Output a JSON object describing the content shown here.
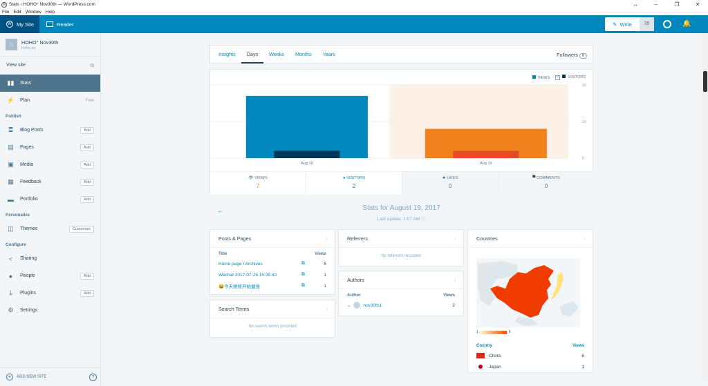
{
  "window": {
    "title": "Stats ‹ HOHO° Nov30th — WordPress.com",
    "menu": [
      "File",
      "Edit",
      "Window",
      "Help"
    ]
  },
  "masterbar": {
    "my_site": "My Site",
    "reader": "Reader",
    "write": "Write",
    "count": "35"
  },
  "sidebar": {
    "site_name": "HOHO° Nov30th",
    "site_url": "hoho.im",
    "view_site": "View site",
    "items": [
      {
        "label": "Stats"
      },
      {
        "label": "Plan",
        "extra": "Free"
      }
    ],
    "publish_heading": "Publish",
    "publish": [
      {
        "label": "Blog Posts",
        "button": "Add"
      },
      {
        "label": "Pages",
        "button": "Add"
      },
      {
        "label": "Media",
        "button": "Add"
      },
      {
        "label": "Feedback",
        "button": "Add"
      },
      {
        "label": "Portfolio",
        "button": "Add"
      }
    ],
    "personalize_heading": "Personalize",
    "personalize": [
      {
        "label": "Themes",
        "button": "Customize"
      }
    ],
    "configure_heading": "Configure",
    "configure": [
      {
        "label": "Sharing",
        "button": ""
      },
      {
        "label": "People",
        "button": "Add"
      },
      {
        "label": "Plugins",
        "button": "Add"
      },
      {
        "label": "Settings",
        "button": ""
      }
    ],
    "add_new_site": "ADD NEW SITE"
  },
  "tabs": [
    "Insights",
    "Days",
    "Weeks",
    "Months",
    "Years"
  ],
  "followers": {
    "label": "Followers",
    "count": "0"
  },
  "legend": {
    "views": "VIEWS",
    "visitors": "VISITORS"
  },
  "chart_data": {
    "type": "bar",
    "categories": [
      "Aug 18",
      "Aug 19"
    ],
    "series": [
      {
        "name": "VIEWS",
        "values": [
          17,
          8
        ]
      },
      {
        "name": "VISITORS",
        "values": [
          2,
          2
        ]
      }
    ],
    "ylim": [
      0,
      20
    ],
    "yticks": [
      "20",
      "10",
      "0"
    ],
    "colors": {
      "views": "#0087be",
      "visitors": "#00375a",
      "views_selected": "#f0821e",
      "visitors_selected": "#e34c24",
      "highlight": "#fdf1e6"
    }
  },
  "summary": [
    {
      "icon": "eye-icon",
      "label": "VIEWS",
      "value": "7"
    },
    {
      "icon": "person-icon",
      "label": "VISITORS",
      "value": "2"
    },
    {
      "icon": "star-icon",
      "label": "LIKES",
      "value": "0"
    },
    {
      "icon": "comment-icon",
      "label": "COMMENTS",
      "value": "0"
    }
  ],
  "stats_for": {
    "title": "Stats for August 19, 2017",
    "last_update": "Last update: 1:07 AM"
  },
  "posts": {
    "title": "Posts & Pages",
    "col_title": "Title",
    "col_views": "Views",
    "rows": [
      {
        "title": "Home page / Archives",
        "views": "5"
      },
      {
        "title": "Wechat 2017-07-26 15:39:43",
        "views": "1"
      },
      {
        "title": "😆今天继续开始健身",
        "views": "1"
      }
    ]
  },
  "search_terms": {
    "title": "Search Terms",
    "empty": "No search terms recorded"
  },
  "referrers": {
    "title": "Referrers",
    "empty": "No referrers recorded"
  },
  "authors": {
    "title": "Authors",
    "col_author": "Author",
    "col_views": "Views",
    "rows": [
      {
        "name": "nov30th1",
        "views": "2"
      }
    ]
  },
  "countries": {
    "title": "Countries",
    "scale_min": "1",
    "scale_max": "6",
    "col_country": "Country",
    "col_views": "Views",
    "rows": [
      {
        "name": "China",
        "views": "6",
        "flag_color": "#de2910"
      },
      {
        "name": "Japan",
        "views": "1",
        "flag_color": "#bc002d"
      }
    ]
  }
}
